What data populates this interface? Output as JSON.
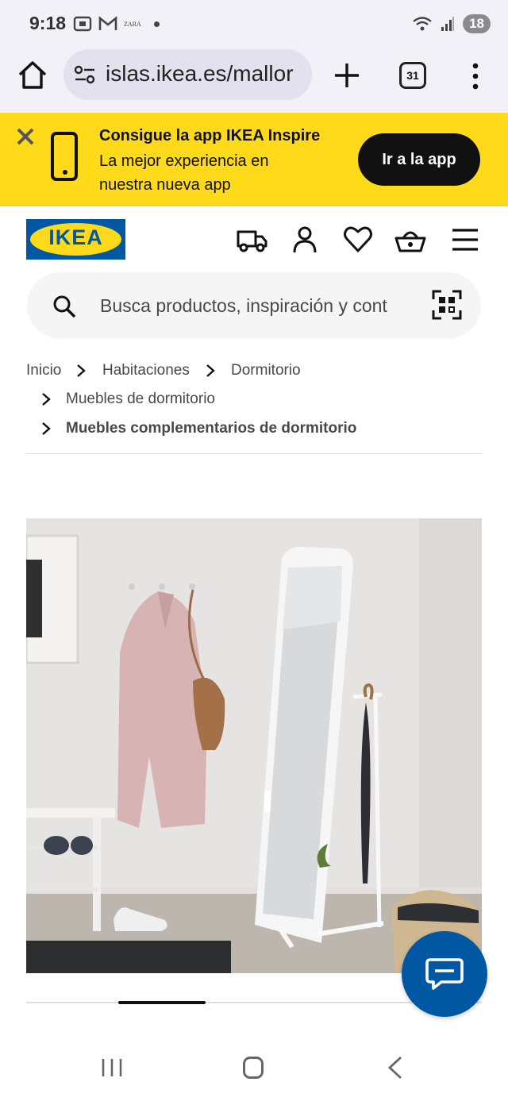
{
  "status_bar": {
    "time": "9:18",
    "notif_icons": [
      "screenshot-icon",
      "gmail-icon",
      "zara-icon",
      "dot-icon"
    ],
    "zara_label": "ZARA",
    "battery": "18"
  },
  "browser": {
    "url": "islas.ikea.es/mallor",
    "tab_count": "31"
  },
  "app_banner": {
    "title": "Consigue la app IKEA Inspire",
    "subtitle": "La mejor experiencia en nuestra nueva app",
    "cta": "Ir a la app",
    "colors": {
      "background": "#ffda1a",
      "button": "#111111"
    }
  },
  "header": {
    "logo_text": "IKEA",
    "icons": [
      "delivery-truck-icon",
      "account-icon",
      "favourites-heart-icon",
      "shopping-bag-icon",
      "menu-hamburger-icon"
    ],
    "brand_colors": {
      "blue": "#0058a3",
      "yellow": "#ffda1a"
    }
  },
  "search": {
    "placeholder": "Busca productos, inspiración y cont"
  },
  "breadcrumb": [
    {
      "label": "Inicio"
    },
    {
      "label": "Habitaciones"
    },
    {
      "label": "Dormitorio"
    },
    {
      "label": "Muebles de dormitorio"
    },
    {
      "label": "Muebles complementarios de dormitorio",
      "current": true
    }
  ],
  "product_image": {
    "image_count_position": 1
  }
}
